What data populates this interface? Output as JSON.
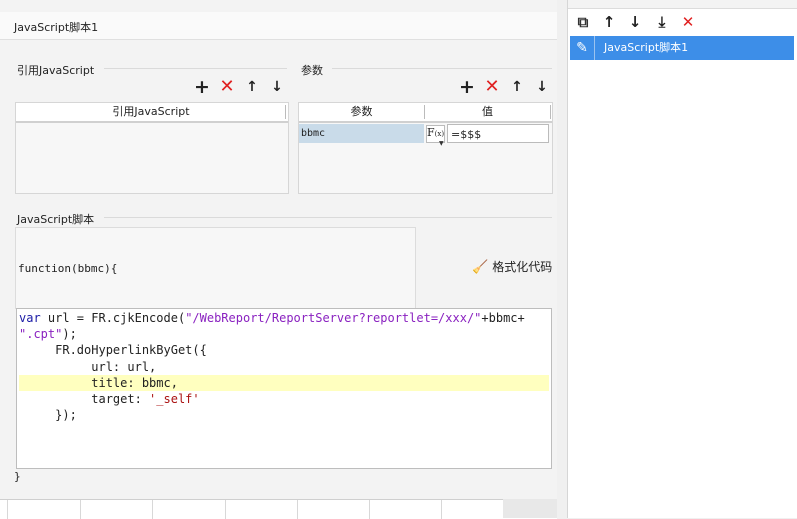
{
  "dialog": {
    "title": "JavaScript脚本1",
    "referenced_js": {
      "section_label": "引用JavaScript",
      "column_header": "引用JavaScript"
    },
    "params": {
      "section_label": "参数",
      "columns": [
        "参数",
        "值"
      ],
      "rows": [
        {
          "name": "bbmc",
          "fx": "F",
          "fx_sub": "(x)",
          "value": "=$$$"
        }
      ]
    },
    "script": {
      "section_label": "JavaScript脚本",
      "signature": "function(bbmc){",
      "format_label": "格式化代码",
      "closing": "}",
      "code": {
        "l1_kw": "var",
        "l1_mid": " url = FR.cjkEncode(",
        "l1_str": "\"/WebReport/ReportServer?reportlet=/xxx/\"",
        "l1_end": "+bbmc+",
        "l2_str": "\".cpt\"",
        "l2_end": ");",
        "l3": "     FR.doHyperlinkByGet({",
        "l4": "          url: url,",
        "l5": "          title: bbmc,",
        "l6_a": "          target: ",
        "l6_str": "'_self'",
        "l7": "     });"
      }
    }
  },
  "toolbar": {
    "add": "+",
    "delete": "✕",
    "up": "↑",
    "down": "↓"
  },
  "right_panel": {
    "item_label": "JavaScript脚本1",
    "buttons": {
      "copy": "⧉",
      "up": "↑",
      "down": "↓",
      "move_bottom": "⤓",
      "delete": "✕"
    }
  },
  "colors": {
    "accent": "#3d8ee8",
    "delete": "#e02020",
    "highlight": "#ffffbf"
  }
}
